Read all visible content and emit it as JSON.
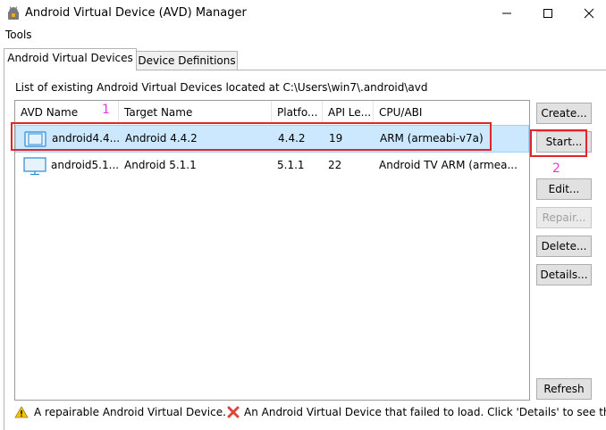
{
  "window": {
    "title": "Android Virtual Device (AVD) Manager",
    "icons": {
      "app": "android-icon",
      "minimize": "minimize-icon",
      "maximize": "maximize-icon",
      "close": "close-icon"
    }
  },
  "menu": {
    "items": [
      {
        "label": "Tools"
      }
    ]
  },
  "tabs": [
    {
      "label": "Android Virtual Devices",
      "active": true
    },
    {
      "label": "Device Definitions",
      "active": false
    }
  ],
  "list": {
    "description": "List of existing Android Virtual Devices located at C:\\Users\\win7\\.android\\avd",
    "columns": [
      "AVD Name",
      "Target Name",
      "Platfo...",
      "API Le...",
      "CPU/ABI"
    ],
    "rows": [
      {
        "icon": "phone-icon",
        "name": "android4.4...",
        "target": "Android 4.4.2",
        "platform": "4.4.2",
        "api": "19",
        "cpu": "ARM (armeabi-v7a)",
        "selected": true
      },
      {
        "icon": "tv-icon",
        "name": "android5.1...",
        "target": "Android 5.1.1",
        "platform": "5.1.1",
        "api": "22",
        "cpu": "Android TV ARM (armea...",
        "selected": false
      }
    ]
  },
  "buttons": {
    "create": "Create...",
    "start": "Start...",
    "edit": "Edit...",
    "repair": "Repair...",
    "delete": "Delete...",
    "details": "Details...",
    "refresh": "Refresh"
  },
  "legend": {
    "warning_text": "A repairable Android Virtual Device.",
    "error_text": "An Android Virtual Device that failed to load. Click 'Details' to see th"
  },
  "annotations": {
    "label_1": "1",
    "label_2": "2",
    "color": "#e0262b",
    "number_color": "#e23bd9"
  },
  "colors": {
    "selection": "#cce8ff",
    "selection_border": "#99d1ff",
    "warning": "#f5c400",
    "error": "#e1443a"
  }
}
